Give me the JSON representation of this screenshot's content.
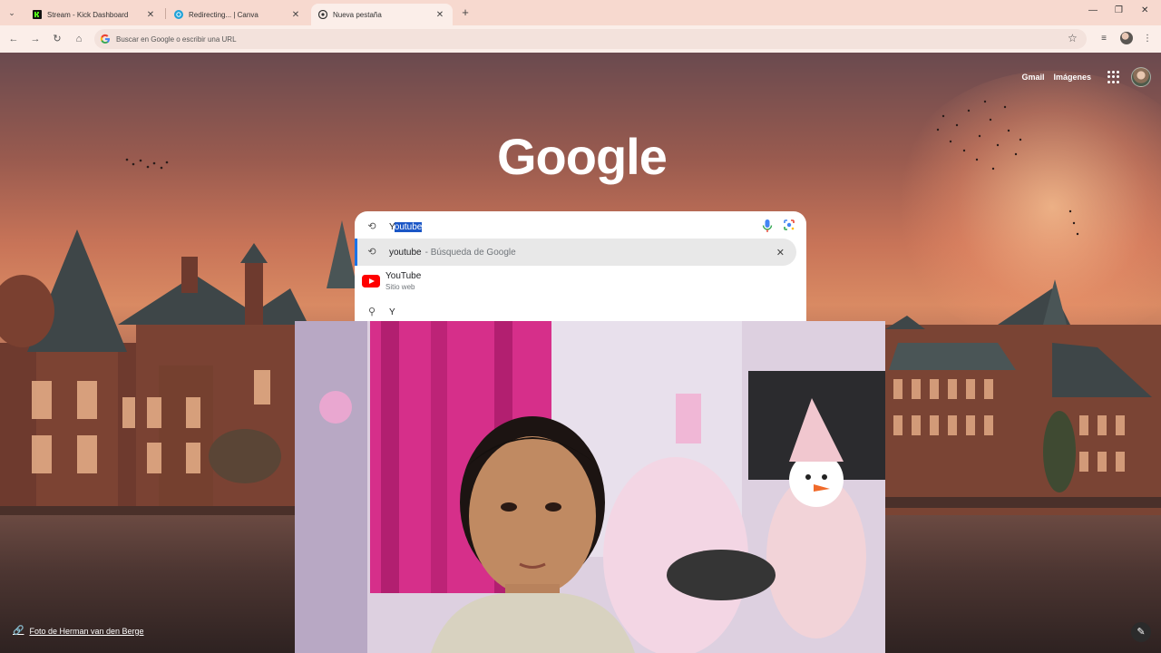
{
  "tabs": [
    {
      "label": "Stream - Kick Dashboard",
      "favicon": "kick-icon"
    },
    {
      "label": "Redirecting... | Canva",
      "favicon": "canva-icon"
    },
    {
      "label": "Nueva pestaña",
      "favicon": "chrome-icon",
      "active": true
    }
  ],
  "address_bar": {
    "placeholder": "Buscar en Google o escribir una URL"
  },
  "google": {
    "logo": "Google",
    "top_links": {
      "gmail": "Gmail",
      "images": "Imágenes"
    },
    "search_query": "youtube",
    "query_first_char": "Y",
    "query_selected": "outube",
    "suggestions": [
      {
        "term": "youtube",
        "sub": "- Búsqueda de Google",
        "icon": "history-icon"
      },
      {
        "title": "YouTube",
        "sub": "Sitio web",
        "icon": "youtube-icon"
      },
      {
        "term": "Y",
        "icon": "search-icon"
      }
    ],
    "background_credit": "Foto de Herman van den Berge"
  },
  "colors": {
    "accent": "#1a73e8",
    "tabbar": "#f7d9cf",
    "youtube": "#ff0000"
  }
}
